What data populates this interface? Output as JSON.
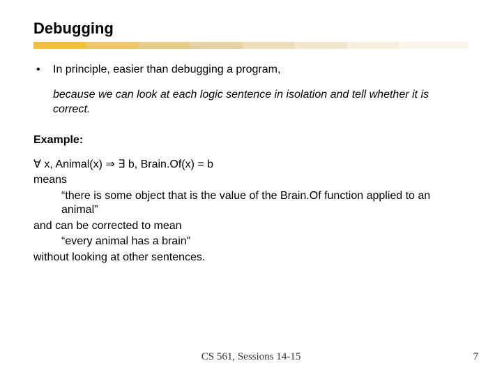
{
  "title": "Debugging",
  "bullet": "In principle, easier than debugging a program,",
  "reason": "because we can look at each logic sentence in isolation and tell whether it is correct.",
  "example_label": "Example:",
  "logic_line": "∀ x, Animal(x) ⇒ ∃ b, Brain.Of(x) = b",
  "means": "means",
  "quote1": "“there is some object that is the value of the Brain.Of function applied to an animal”",
  "corrected": "and can be corrected to mean",
  "quote2": "“every animal has a brain”",
  "without": "without looking at other sentences.",
  "footer": "CS 561,  Sessions 14-15",
  "page": "7"
}
